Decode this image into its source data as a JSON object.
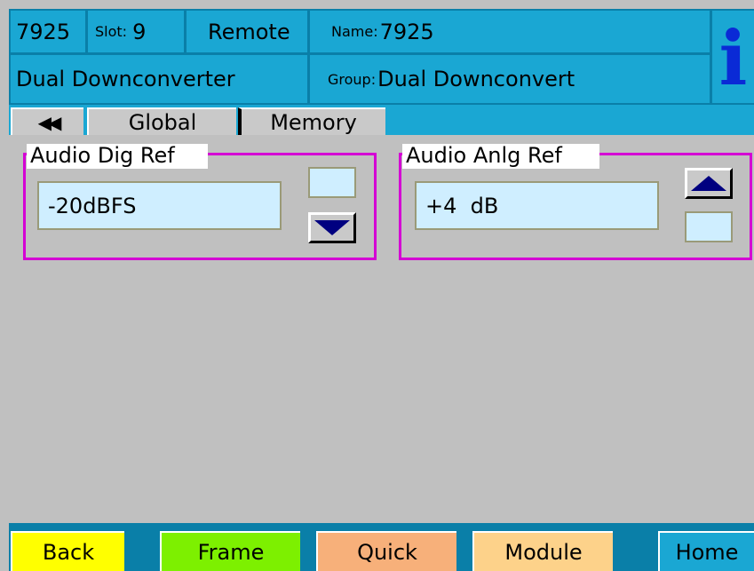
{
  "header": {
    "device_id": "7925",
    "slot_label": "Slot:",
    "slot_value": "9",
    "mode": "Remote",
    "name_label": "Name:",
    "name_value": "7925",
    "device_type": "Dual Downconverter",
    "group_label": "Group:",
    "group_value": "Dual Downconvert",
    "info_icon_glyph": "i"
  },
  "tabs": {
    "back_glyph": "◀◀",
    "items": [
      {
        "label": "Global"
      },
      {
        "label": "Memory"
      }
    ]
  },
  "panels": {
    "dig": {
      "title": "Audio Dig Ref",
      "value": "-20dBFS"
    },
    "anlg": {
      "title": "Audio Anlg Ref",
      "value": "+4  dB"
    }
  },
  "footer": {
    "back": "Back",
    "frame": "Frame",
    "quick": "Quick",
    "module": "Module",
    "home": "Home"
  },
  "colors": {
    "header_cell": "#1aa7d3",
    "header_bg": "#0a7fa8",
    "panel_border": "#d400d4",
    "value_bg": "#cfeeff",
    "info_icon": "#0a2ad6",
    "back_button": "#ffff00",
    "frame_button": "#7df000",
    "quick_button": "#f7b07a",
    "module_button": "#fdd28a",
    "home_button": "#1aa7d3"
  }
}
